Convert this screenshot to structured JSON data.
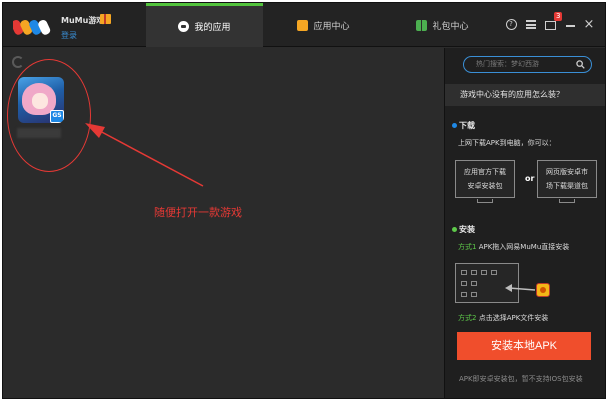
{
  "titlebar": {
    "brand": "MuMu游戏",
    "login": "登录",
    "tabs": [
      {
        "label": "我的应用",
        "active": true,
        "icon": "my-apps-icon"
      },
      {
        "label": "应用中心",
        "active": false,
        "icon": "app-center-icon"
      },
      {
        "label": "礼包中心",
        "active": false,
        "icon": "gift-center-icon"
      }
    ],
    "controls": {
      "help": "?",
      "message_badge": "3",
      "close": "×"
    }
  },
  "left": {
    "app_badge": "GS",
    "hint_text": "随便打开一款游戏"
  },
  "right": {
    "search_placeholder": "热门搜索：梦幻西游",
    "question": "游戏中心没有的应用怎么装？",
    "download": {
      "title": "下载",
      "desc": "上网下载APK到电脑，你可以：",
      "option1_line1": "应用官方下载",
      "option1_line2": "安卓安装包",
      "or": "or",
      "option2_line1": "网页版安卓市",
      "option2_line2": "场下载渠道包"
    },
    "install": {
      "title": "安装",
      "method1_label": "方式1",
      "method1_text": "APK拖入网易MuMu直接安装",
      "method2_label": "方式2",
      "method2_text": "点击选择APK文件安装"
    },
    "install_button": "安装本地APK",
    "footnote": "APK即安卓安装包，暂不支持IOS包安装"
  },
  "colors": {
    "accent_green": "#52c33c",
    "link_blue": "#3a8fd6",
    "install_red": "#f04e2c",
    "annotation_red": "#e53935"
  }
}
